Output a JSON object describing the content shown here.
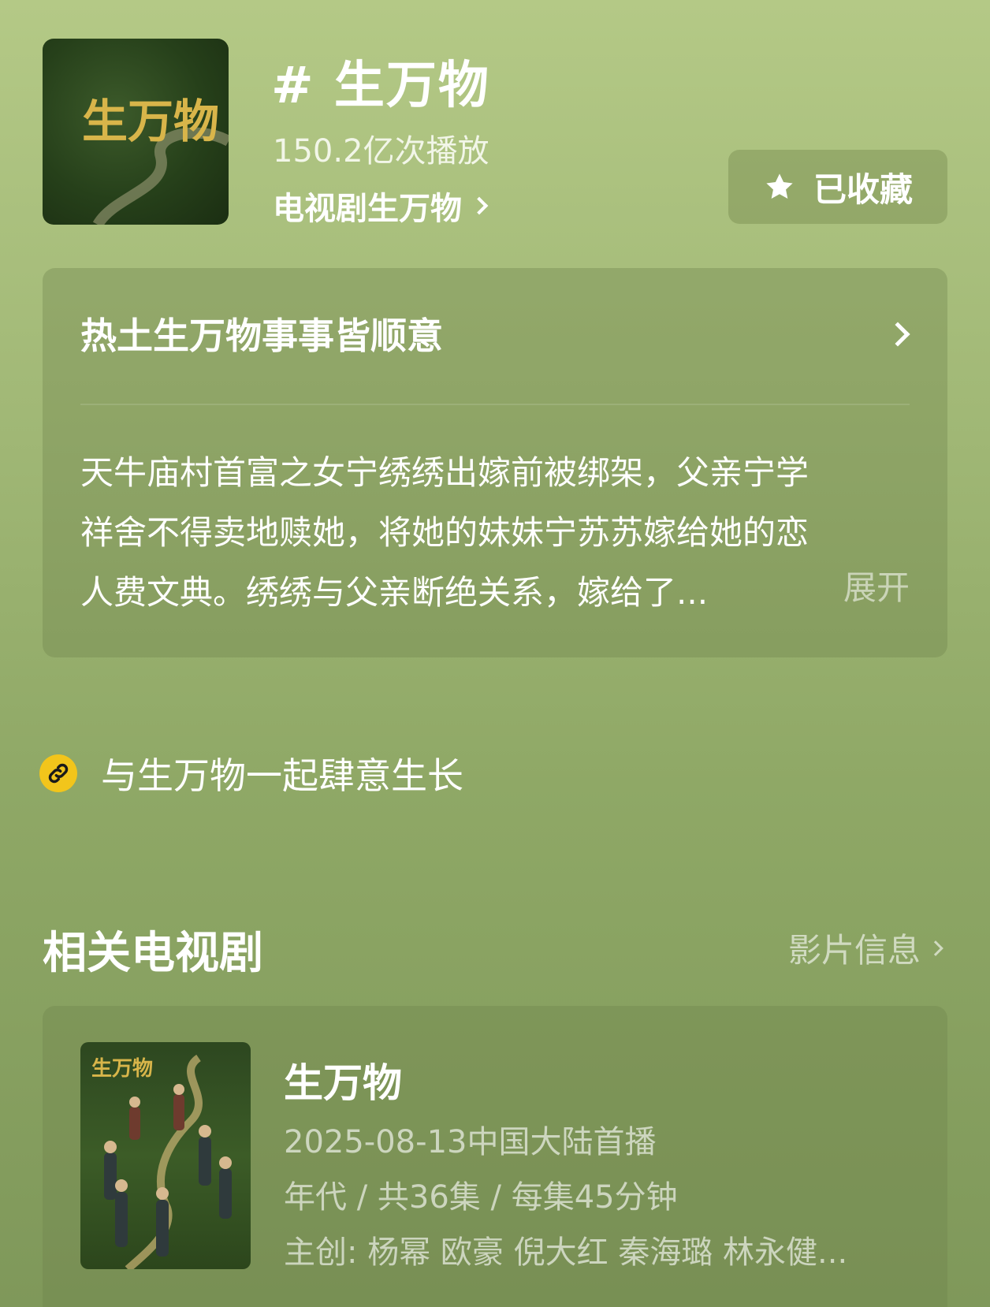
{
  "header": {
    "title": "# 生万物",
    "plays": "150.2亿次播放",
    "drama_link": "电视剧生万物",
    "favorite_label": "已收藏",
    "cover_logo_text": "生万物"
  },
  "description": {
    "title": "热土生万物事事皆顺意",
    "lines": [
      "天牛庙村首富之女宁绣绣出嫁前被绑架，父亲宁学",
      "祥舍不得卖地赎她，将她的妹妹宁苏苏嫁给她的恋",
      "人费文典。绣绣与父亲断绝关系，嫁给了..."
    ],
    "expand_label": "展开"
  },
  "link_row": {
    "text": "与生万物一起肆意生长",
    "icon": "link-icon"
  },
  "related": {
    "title": "相关电视剧",
    "more_label": "影片信息",
    "item": {
      "name": "生万物",
      "premiere": "2025-08-13中国大陆首播",
      "info": "年代 / 共36集 / 每集45分钟",
      "cast": "主创: 杨幂 欧豪 倪大红 秦海璐 林永健..."
    }
  },
  "colors": {
    "background_top": "#b4c986",
    "background_bottom": "#7f985a",
    "link_icon": "#f2c51b"
  }
}
